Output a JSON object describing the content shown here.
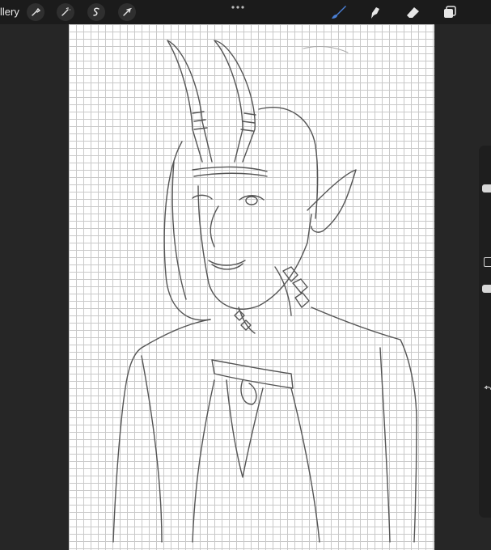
{
  "app": {
    "gallery_label": "llery"
  },
  "toolbar": {
    "left_tools": [
      "wrench-icon",
      "magic-wand-icon",
      "selection-icon",
      "transform-arrow-icon"
    ],
    "right_tools": [
      "brush-icon",
      "smudge-icon",
      "eraser-icon",
      "layers-icon"
    ],
    "active_tool": "brush",
    "accent_color": "#4a7fd4"
  },
  "sidebar": {
    "size_slider_level": 0.12,
    "opacity_slider_level": 0.38
  },
  "canvas": {
    "background": "grid paper",
    "grid_color": "#c9c9c9"
  }
}
